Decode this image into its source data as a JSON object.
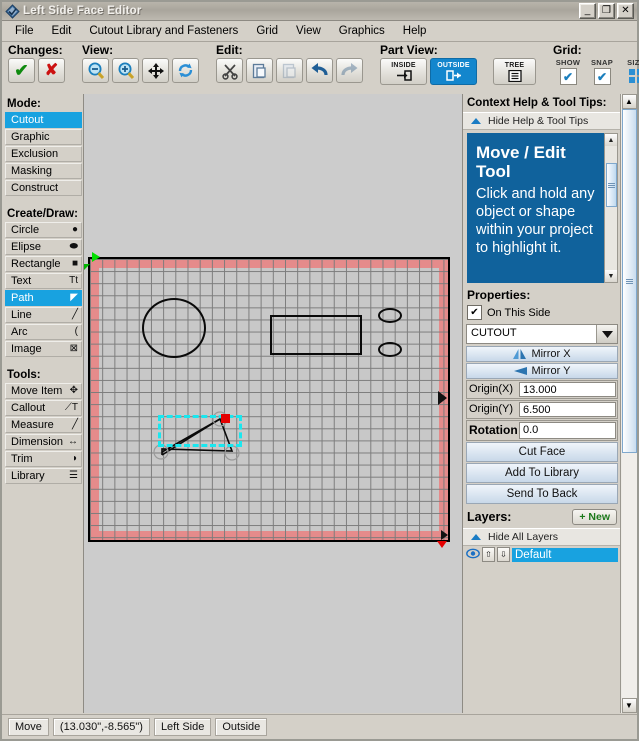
{
  "window": {
    "title": "Left Side Face Editor",
    "icon": "app-diamond-icon",
    "buttons": {
      "minimize": "_",
      "maximize": "❐",
      "close": "✕"
    }
  },
  "menubar": [
    {
      "label": "File"
    },
    {
      "label": "Edit"
    },
    {
      "label": "Cutout Library and Fasteners"
    },
    {
      "label": "Grid"
    },
    {
      "label": "View"
    },
    {
      "label": "Graphics"
    },
    {
      "label": "Help"
    }
  ],
  "toolbar": {
    "changes": {
      "label": "Changes:",
      "accept": "✔",
      "cancel": "✘"
    },
    "view": {
      "label": "View:",
      "zoom_out": "zoom-out-icon",
      "zoom_in": "zoom-in-icon",
      "pan": "pan-icon",
      "refresh": "refresh-icon"
    },
    "edit": {
      "label": "Edit:",
      "cut": "scissors-icon",
      "copy": "copy-icon",
      "paste": "paste-icon",
      "undo": "undo-icon",
      "redo": "redo-icon"
    },
    "part_view": {
      "label": "Part View:",
      "inside": "INSIDE",
      "outside": "OUTSIDE",
      "tree": "TREE",
      "selected": "OUTSIDE"
    },
    "grid": {
      "label": "Grid:",
      "show": "SHOW",
      "snap": "SNAP",
      "size": "SIZE",
      "show_checked": "✔",
      "snap_checked": "✔"
    }
  },
  "sidebar": {
    "mode_title": "Mode:",
    "modes": [
      {
        "label": "Cutout",
        "selected": true
      },
      {
        "label": "Graphic",
        "selected": false
      },
      {
        "label": "Exclusion",
        "selected": false
      },
      {
        "label": "Masking",
        "selected": false
      },
      {
        "label": "Construct",
        "selected": false
      }
    ],
    "create_title": "Create/Draw:",
    "create": [
      {
        "label": "Circle",
        "icon": "●",
        "selected": false
      },
      {
        "label": "Elipse",
        "icon": "⬬",
        "selected": false
      },
      {
        "label": "Rectangle",
        "icon": "■",
        "selected": false
      },
      {
        "label": "Text",
        "icon": "Tt",
        "selected": false
      },
      {
        "label": "Path",
        "icon": "◤",
        "selected": true
      },
      {
        "label": "Line",
        "icon": "╱",
        "selected": false
      },
      {
        "label": "Arc",
        "icon": "(",
        "selected": false
      },
      {
        "label": "Image",
        "icon": "⊠",
        "selected": false
      }
    ],
    "tools_title": "Tools:",
    "tools": [
      {
        "label": "Move Item",
        "icon": "✥"
      },
      {
        "label": "Callout",
        "icon": "⟋T"
      },
      {
        "label": "Measure",
        "icon": "╱"
      },
      {
        "label": "Dimension",
        "icon": "↔"
      },
      {
        "label": "Trim",
        "icon": "◗"
      },
      {
        "label": "Library",
        "icon": "☰"
      }
    ]
  },
  "help": {
    "title": "Context Help & Tool Tips:",
    "toggle": "Hide Help & Tool Tips",
    "heading": "Move / Edit Tool",
    "body": "Click and hold any object or shape within your project to highlight it."
  },
  "properties": {
    "title": "Properties:",
    "on_this_side_label": "On This Side",
    "on_this_side_checked": "✔",
    "type_value": "CUTOUT",
    "mirror_x": "Mirror X",
    "mirror_y": "Mirror Y",
    "origin_x_label": "Origin(X)",
    "origin_x_value": "13.000",
    "origin_y_label": "Origin(Y)",
    "origin_y_value": "6.500",
    "rotation_label": "Rotation",
    "rotation_value": "0.0",
    "cut_face": "Cut Face",
    "add_to_library": "Add To Library",
    "send_to_back": "Send To Back"
  },
  "layers": {
    "title": "Layers:",
    "new_button": "+ New",
    "toggle": "Hide All Layers",
    "items": [
      {
        "name": "Default",
        "visible_icon": "👁",
        "up_icon": "⇧",
        "down_icon": "⇩",
        "selected": true
      }
    ]
  },
  "statusbar": {
    "mode": "Move",
    "coords": "(13.030\",-8.565\")",
    "side": "Left Side",
    "face": "Outside"
  },
  "colors": {
    "accent_blue": "#18a2e0",
    "help_blue": "#10629c",
    "chrome": "#d4d0c8",
    "edge_red": "#e58b8b",
    "selection_cyan": "#19e7ef",
    "handle_red": "#e40000",
    "origin_green": "#00e000"
  },
  "canvas": {
    "shapes": [
      {
        "name": "circle-cutout",
        "type": "circle"
      },
      {
        "name": "rectangle-cutout",
        "type": "rectangle"
      },
      {
        "name": "oval-cutout-top",
        "type": "oval"
      },
      {
        "name": "oval-cutout-bottom",
        "type": "oval"
      },
      {
        "name": "path-cutout-selected",
        "type": "path",
        "selected": true
      }
    ]
  }
}
